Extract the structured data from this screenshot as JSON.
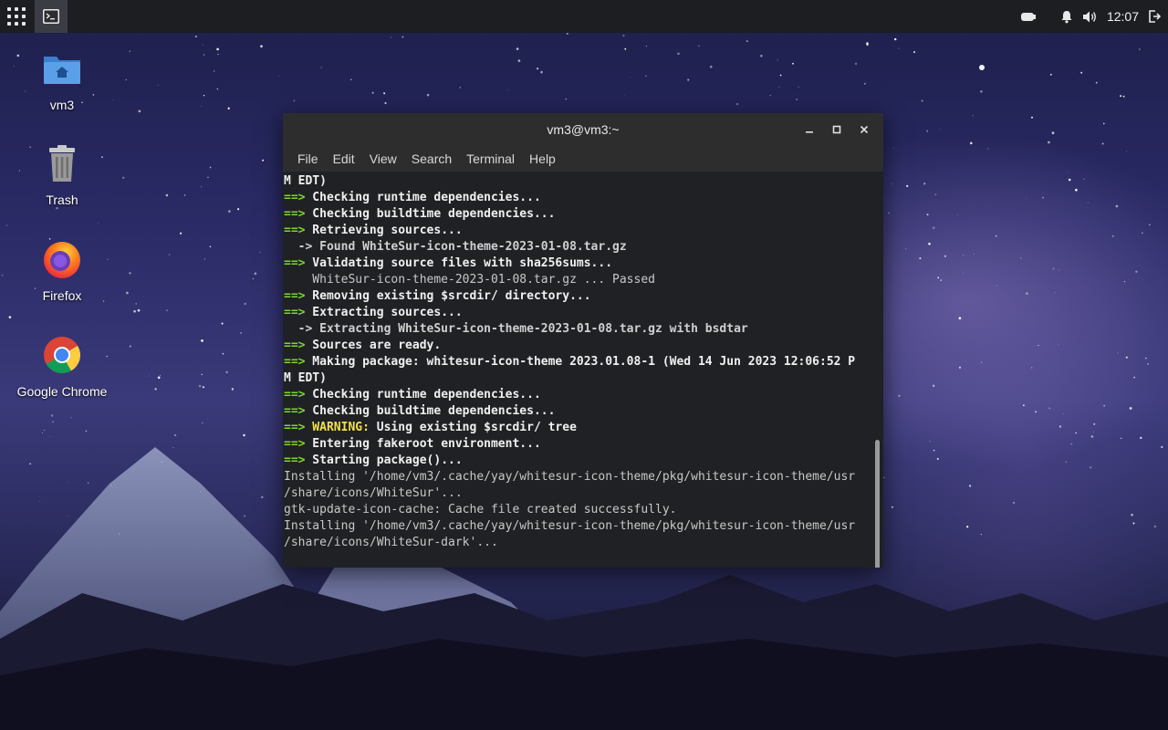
{
  "topbar": {
    "clock": "12:07"
  },
  "desktop_icons": [
    {
      "label": "vm3",
      "icon": "home-folder-icon"
    },
    {
      "label": "Trash",
      "icon": "trash-icon"
    },
    {
      "label": "Firefox",
      "icon": "firefox-icon"
    },
    {
      "label": "Google Chrome",
      "icon": "chrome-icon"
    }
  ],
  "terminal": {
    "title": "vm3@vm3:~",
    "menu": [
      "File",
      "Edit",
      "View",
      "Search",
      "Terminal",
      "Help"
    ],
    "lines": [
      {
        "prefix": "",
        "text": "M EDT)",
        "style": "bold"
      },
      {
        "prefix": "==>",
        "text": " Checking runtime dependencies...",
        "style": "bold"
      },
      {
        "prefix": "==>",
        "text": " Checking buildtime dependencies...",
        "style": "bold"
      },
      {
        "prefix": "==>",
        "text": " Retrieving sources...",
        "style": "bold"
      },
      {
        "prefix": "",
        "text": "  -> Found WhiteSur-icon-theme-2023-01-08.tar.gz",
        "style": "sub"
      },
      {
        "prefix": "==>",
        "text": " Validating source files with sha256sums...",
        "style": "bold"
      },
      {
        "prefix": "",
        "text": "    WhiteSur-icon-theme-2023-01-08.tar.gz ... Passed",
        "style": "plain"
      },
      {
        "prefix": "==>",
        "text": " Removing existing $srcdir/ directory...",
        "style": "bold"
      },
      {
        "prefix": "==>",
        "text": " Extracting sources...",
        "style": "bold"
      },
      {
        "prefix": "",
        "text": "  -> Extracting WhiteSur-icon-theme-2023-01-08.tar.gz with bsdtar",
        "style": "sub"
      },
      {
        "prefix": "==>",
        "text": " Sources are ready.",
        "style": "bold"
      },
      {
        "prefix": "==>",
        "text": " Making package: whitesur-icon-theme 2023.01.08-1 (Wed 14 Jun 2023 12:06:52 P",
        "style": "bold"
      },
      {
        "prefix": "",
        "text": "M EDT)",
        "style": "bold"
      },
      {
        "prefix": "==>",
        "text": " Checking runtime dependencies...",
        "style": "bold"
      },
      {
        "prefix": "==>",
        "text": " Checking buildtime dependencies...",
        "style": "bold"
      },
      {
        "prefix": "==>",
        "text": " WARNING:",
        "style": "warn",
        "rest": " Using existing $srcdir/ tree"
      },
      {
        "prefix": "==>",
        "text": " Entering fakeroot environment...",
        "style": "bold"
      },
      {
        "prefix": "==>",
        "text": " Starting package()...",
        "style": "bold"
      },
      {
        "prefix": "",
        "text": "Installing '/home/vm3/.cache/yay/whitesur-icon-theme/pkg/whitesur-icon-theme/usr",
        "style": "plain"
      },
      {
        "prefix": "",
        "text": "/share/icons/WhiteSur'...",
        "style": "plain"
      },
      {
        "prefix": "",
        "text": "gtk-update-icon-cache: Cache file created successfully.",
        "style": "plain"
      },
      {
        "prefix": "",
        "text": "Installing '/home/vm3/.cache/yay/whitesur-icon-theme/pkg/whitesur-icon-theme/usr",
        "style": "plain"
      },
      {
        "prefix": "",
        "text": "/share/icons/WhiteSur-dark'...",
        "style": "plain"
      }
    ]
  }
}
